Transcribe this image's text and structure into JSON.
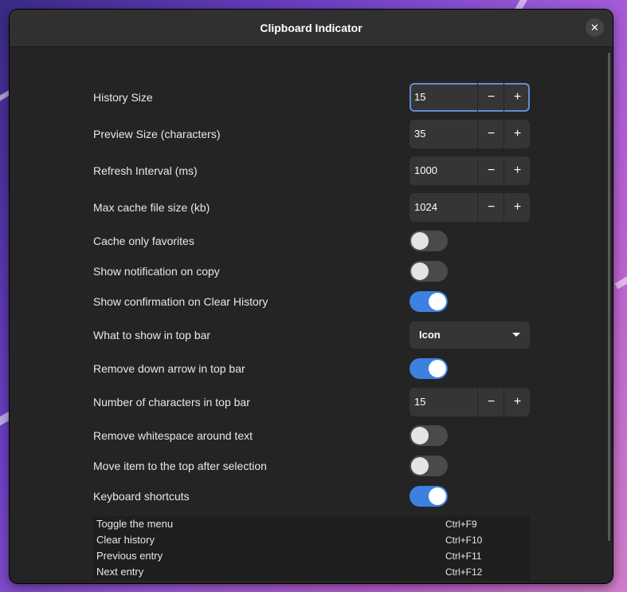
{
  "window": {
    "title": "Clipboard Indicator",
    "close_glyph": "✕"
  },
  "settings": {
    "history_size": {
      "label": "History Size",
      "value": "15"
    },
    "preview_size": {
      "label": "Preview Size (characters)",
      "value": "35"
    },
    "refresh_interval": {
      "label": "Refresh Interval (ms)",
      "value": "1000"
    },
    "max_cache": {
      "label": "Max cache file size (kb)",
      "value": "1024"
    },
    "cache_only_favorites": {
      "label": "Cache only favorites",
      "on": false
    },
    "show_notification": {
      "label": "Show notification on copy",
      "on": false
    },
    "show_confirmation": {
      "label": "Show confirmation on Clear History",
      "on": true
    },
    "top_bar_display": {
      "label": "What to show in top bar",
      "selected": "Icon"
    },
    "remove_down_arrow": {
      "label": "Remove down arrow in top bar",
      "on": true
    },
    "top_bar_chars": {
      "label": "Number of characters in top bar",
      "value": "15"
    },
    "remove_whitespace": {
      "label": "Remove whitespace around text",
      "on": false
    },
    "move_to_top": {
      "label": "Move item to the top after selection",
      "on": false
    },
    "keyboard_shortcuts": {
      "label": "Keyboard shortcuts",
      "on": true
    }
  },
  "spin": {
    "minus": "−",
    "plus": "+"
  },
  "shortcuts": [
    {
      "name": "Toggle the menu",
      "keys": "Ctrl+F9"
    },
    {
      "name": "Clear history",
      "keys": "Ctrl+F10"
    },
    {
      "name": "Previous entry",
      "keys": "Ctrl+F11"
    },
    {
      "name": "Next entry",
      "keys": "Ctrl+F12"
    }
  ],
  "colors": {
    "accent": "#3d80e0",
    "window_bg": "#242424",
    "titlebar_bg": "#303030",
    "control_bg": "#353535",
    "focus_ring": "#5e8fcf"
  },
  "icons": {
    "close": "close-icon",
    "dropdown": "chevron-down-icon"
  }
}
